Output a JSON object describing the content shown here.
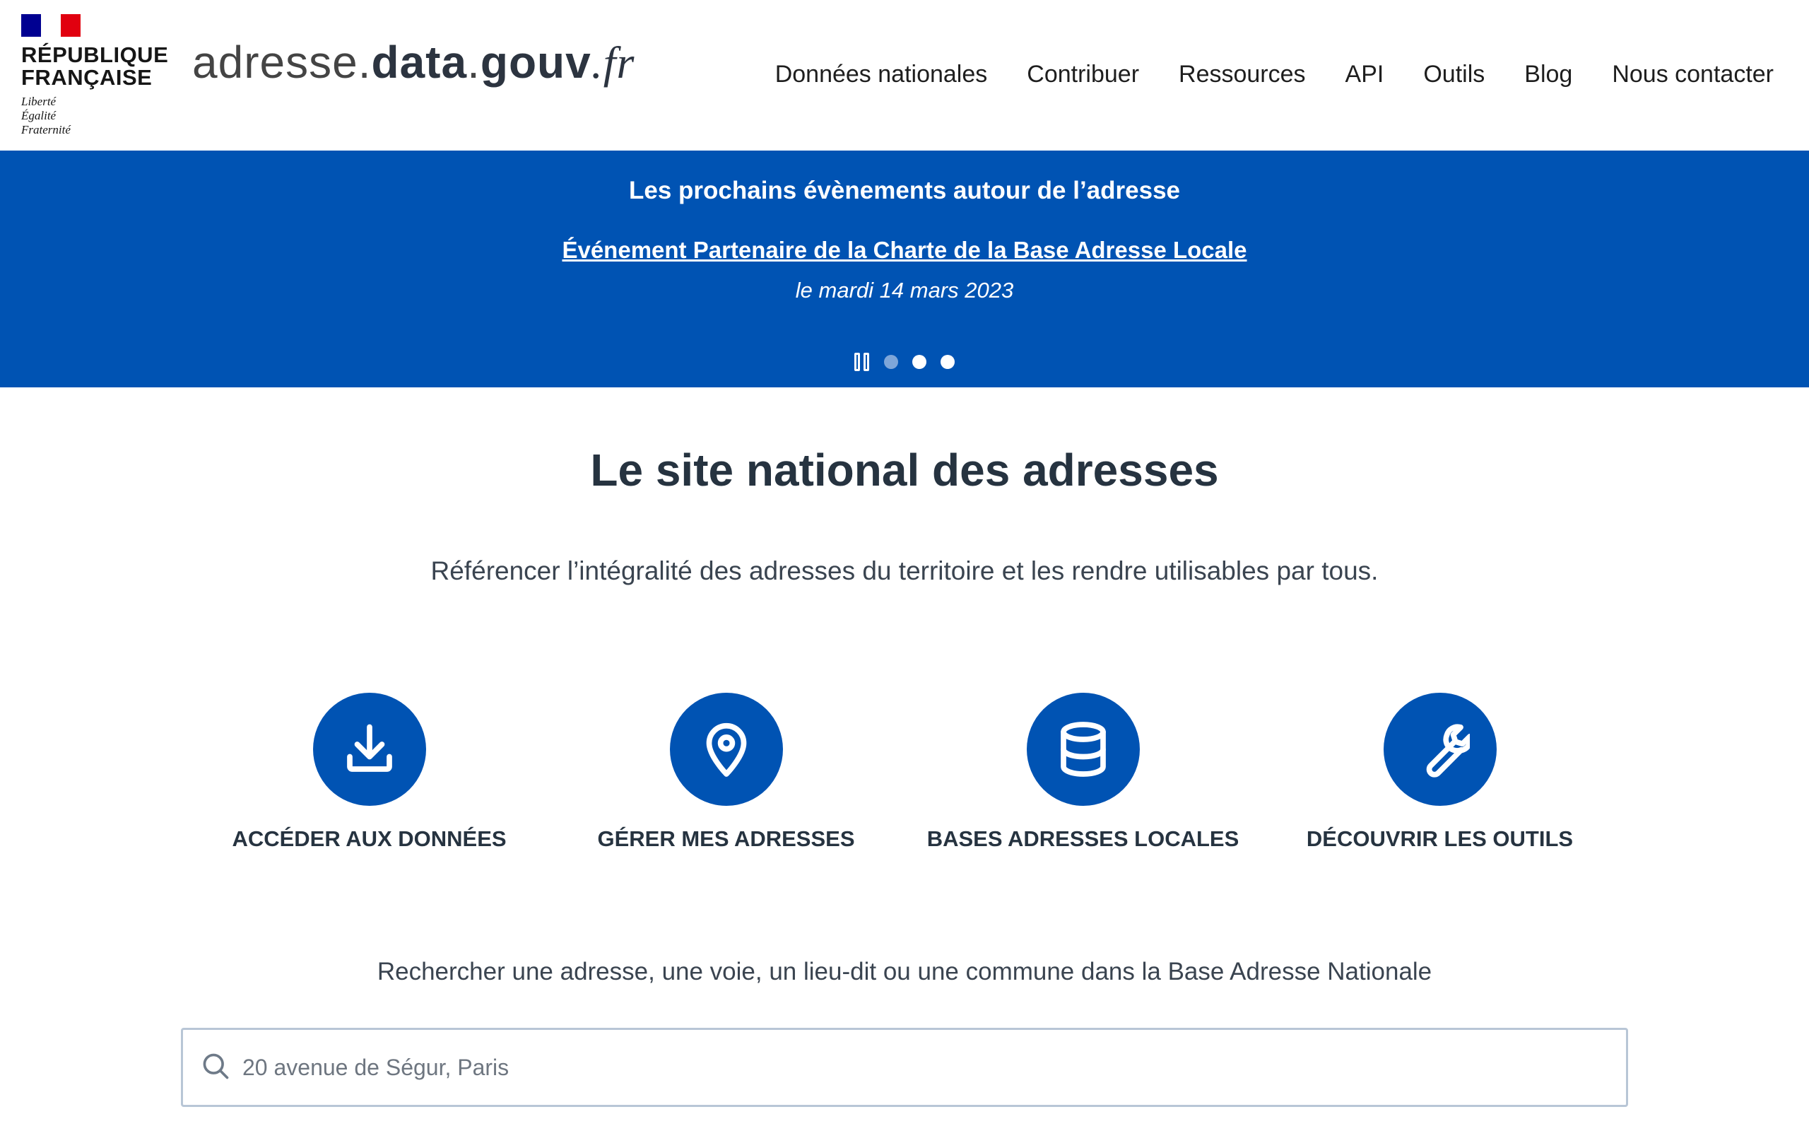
{
  "header": {
    "republic_line1": "RÉPUBLIQUE",
    "republic_line2": "FRANÇAISE",
    "motto_line1": "Liberté",
    "motto_line2": "Égalité",
    "motto_line3": "Fraternité",
    "site_name_part1": "adresse.",
    "site_name_part2": "data",
    "site_name_part3": ".",
    "site_name_part4": "gouv",
    "site_name_part5": ".fr"
  },
  "nav": {
    "items": [
      {
        "label": "Données nationales"
      },
      {
        "label": "Contribuer"
      },
      {
        "label": "Ressources"
      },
      {
        "label": "API"
      },
      {
        "label": "Outils"
      },
      {
        "label": "Blog"
      },
      {
        "label": "Nous contacter"
      }
    ]
  },
  "banner": {
    "title": "Les prochains évènements autour de l’adresse",
    "event_link": "Événement Partenaire de la Charte de la Base Adresse Locale",
    "event_date": "le mardi 14 mars 2023",
    "carousel_pages": 3,
    "active_page": 1
  },
  "main": {
    "title": "Le site national des adresses",
    "subtitle": "Référencer l’intégralité des adresses du territoire et les rendre utilisables par tous.",
    "features": [
      {
        "label": "ACCÉDER AUX DONNÉES",
        "icon": "download-icon"
      },
      {
        "label": "GÉRER MES ADRESSES",
        "icon": "map-pin-icon"
      },
      {
        "label": "BASES ADRESSES LOCALES",
        "icon": "database-icon"
      },
      {
        "label": "DÉCOUVRIR LES OUTILS",
        "icon": "wrench-icon"
      }
    ],
    "search_hint": "Rechercher une adresse, une voie, un lieu-dit ou une commune dans la Base Adresse Nationale",
    "search_placeholder": "20 avenue de Ségur, Paris"
  },
  "colors": {
    "brand_blue": "#0053b3",
    "text_dark": "#263340",
    "flag_blue": "#000091",
    "flag_red": "#e1000f"
  }
}
